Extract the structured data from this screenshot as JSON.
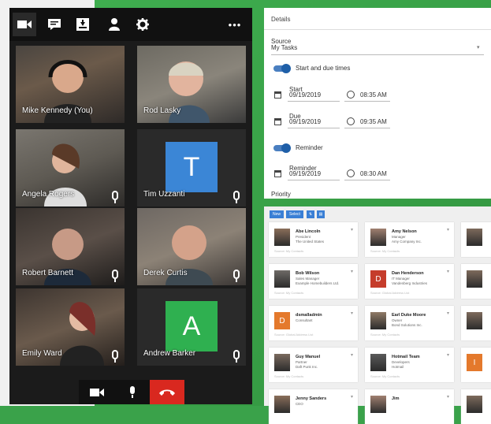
{
  "toolbar": {
    "icons": [
      "video-camera-icon",
      "chat-icon",
      "download-icon",
      "person-icon",
      "gear-icon"
    ],
    "more_label": "•••"
  },
  "participants": [
    {
      "name": "Mike Kennedy (You)"
    },
    {
      "name": "Rod Lasky"
    },
    {
      "name": "Angela Rogers"
    },
    {
      "name": "Tim Uzzanti",
      "initial": "T",
      "color": "#3b86d6"
    },
    {
      "name": "Robert Barnett"
    },
    {
      "name": "Derek Curtis"
    },
    {
      "name": "Emily Ward"
    },
    {
      "name": "Andrew Barker",
      "initial": "A",
      "color": "#2fb050"
    }
  ],
  "call_controls": {
    "accent": "#d9281f"
  },
  "details": {
    "header": "Details",
    "source_label": "Source",
    "source_value": "My Tasks",
    "start_due_label": "Start and due times",
    "start_label": "Start",
    "start_date": "09/19/2019",
    "start_time": "08:35 AM",
    "due_label": "Due",
    "due_date": "09/19/2019",
    "due_time": "09:35 AM",
    "reminder_label": "Reminder",
    "reminder_sub": "Reminder",
    "reminder_date": "09/19/2019",
    "reminder_time": "08:30 AM",
    "priority_label": "Priority"
  },
  "grid": {
    "buttons": [
      "New",
      "Select"
    ],
    "cards": [
      {
        "name": "Abe Lincoln",
        "title": "President",
        "company": "The United States",
        "footer": "Source: My Contacts",
        "type": "photo"
      },
      {
        "name": "Amy Nelson",
        "title": "Manager",
        "company": "Amy Company Inc.",
        "footer": "Source: My Contacts",
        "type": "photo"
      },
      {
        "name": "Bob Wilson",
        "title": "Sales Manager",
        "company": "Example Homebuilders Ltd.",
        "footer": "Source: My Contacts",
        "type": "photo"
      },
      {
        "name": "Dan Henderson",
        "title": "IT Manager",
        "company": "Vandenberg Industries",
        "footer": "Source: Global Address List",
        "type": "letter",
        "initial": "D",
        "color": "#c53c2b"
      },
      {
        "name": "dsmalladmin",
        "title": "Consultant",
        "company": "",
        "footer": "Source: Global Address List",
        "type": "letter",
        "initial": "D",
        "color": "#e4792c"
      },
      {
        "name": "Earl Duke Moore",
        "title": "Owner",
        "company": "Bond Solutions Inc.",
        "footer": "Source: My Contacts",
        "type": "photo"
      },
      {
        "name": "Guy Manuel",
        "title": "Partner",
        "company": "Daft Punk Inc.",
        "footer": "Source: My Contacts",
        "type": "photo"
      },
      {
        "name": "Hotmail Team",
        "title": "Developers",
        "company": "Hotmail",
        "footer": "Source: My Contacts",
        "type": "photo"
      },
      {
        "name": "Jenny Sanders",
        "title": "CEO",
        "company": "",
        "footer": "",
        "type": "photo"
      },
      {
        "name": "Jim",
        "title": "",
        "company": "",
        "footer": "",
        "type": "photo"
      }
    ],
    "partial_letter": "I",
    "partial_letter_color": "#e4792c"
  }
}
